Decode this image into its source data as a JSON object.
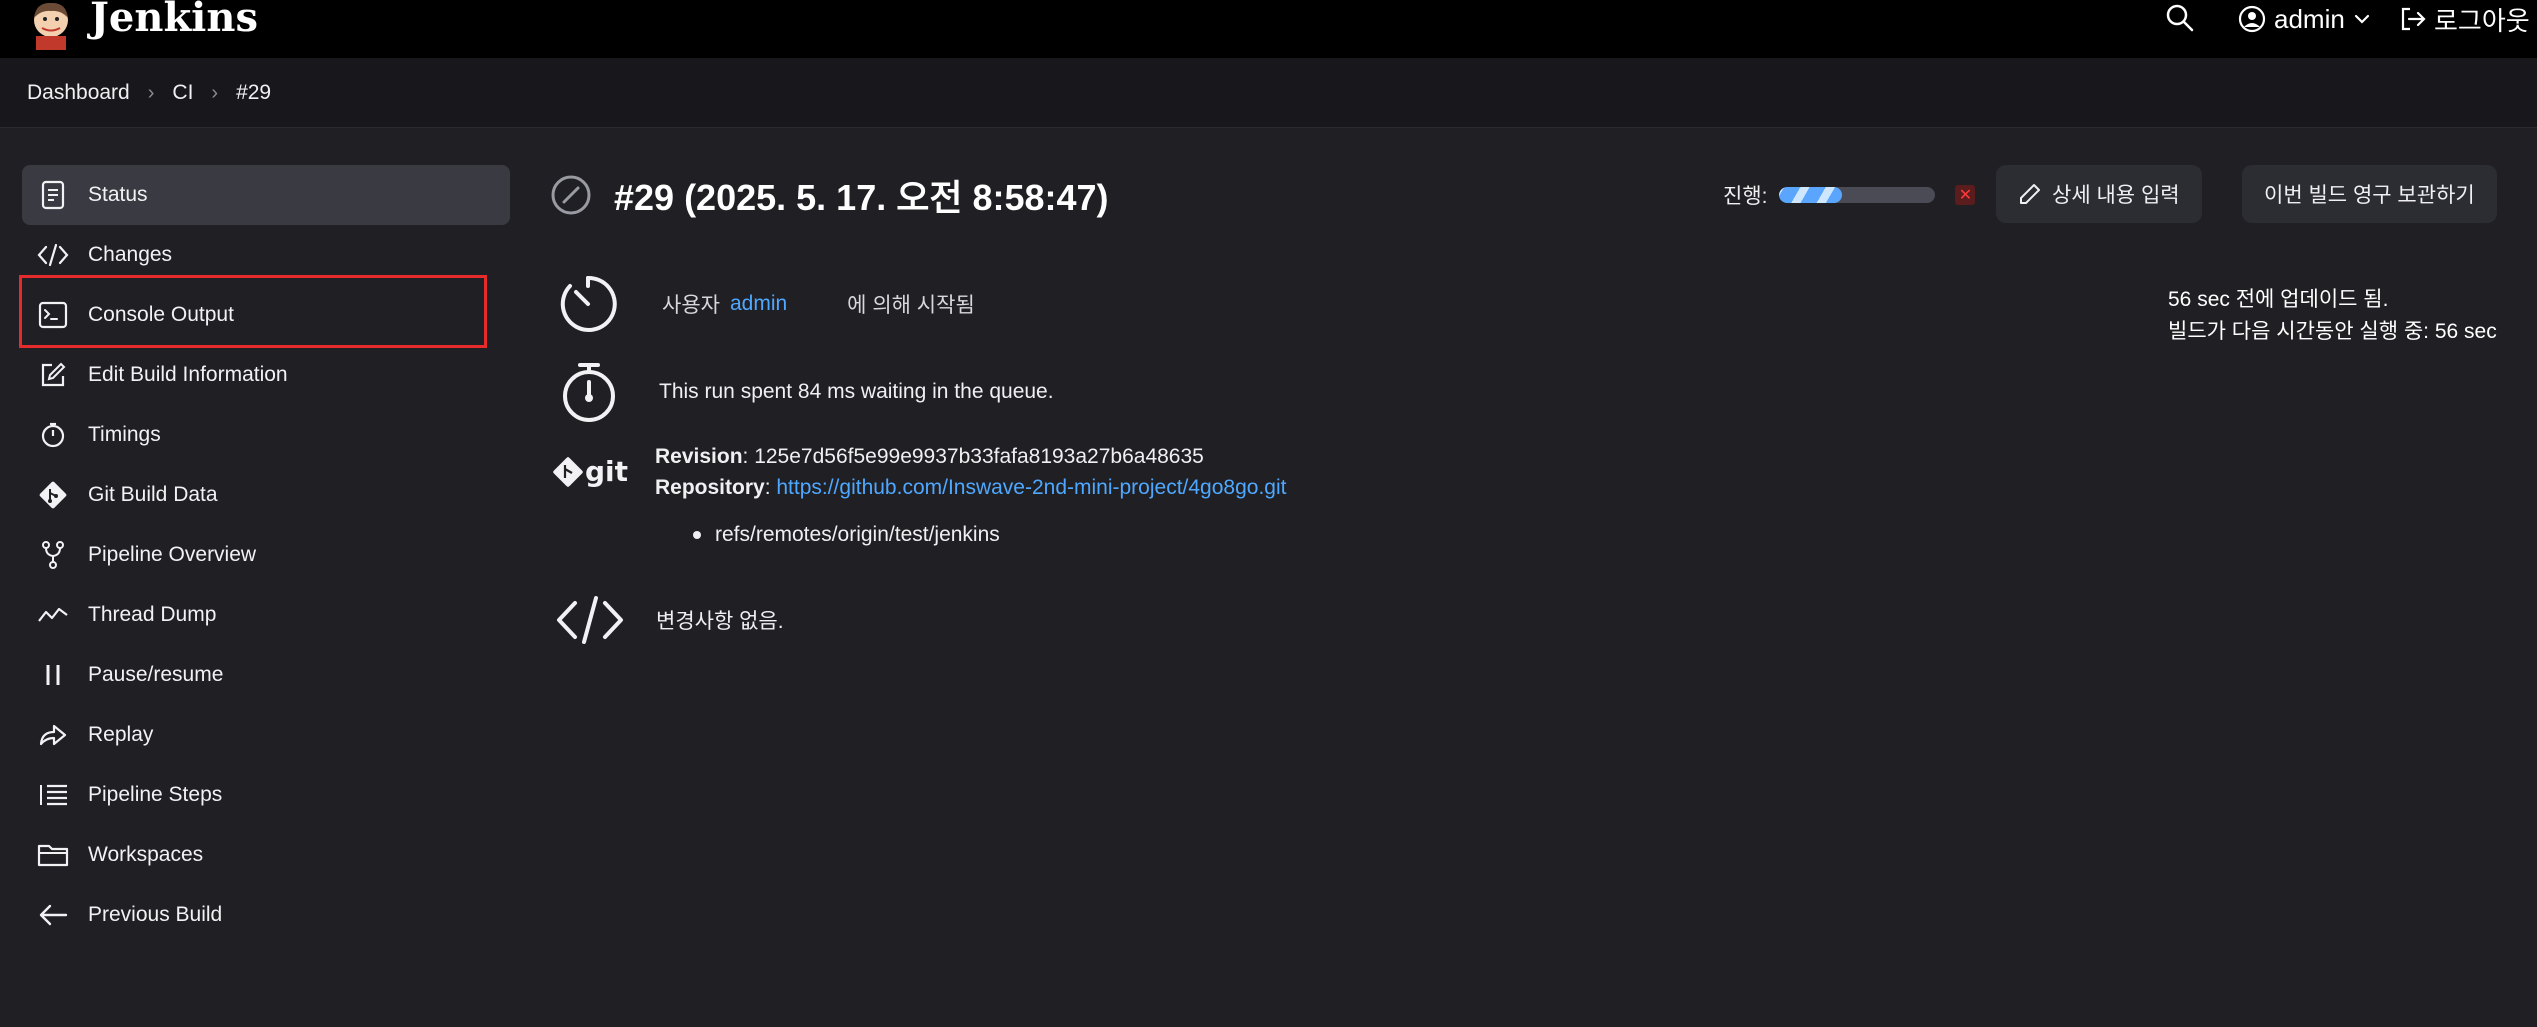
{
  "header": {
    "brand": "Jenkins",
    "user": "admin",
    "logout": "로그아웃"
  },
  "breadcrumb": [
    "Dashboard",
    "CI",
    "#29"
  ],
  "sidebar": {
    "items": [
      {
        "label": "Status",
        "icon": "document-icon"
      },
      {
        "label": "Changes",
        "icon": "code-icon"
      },
      {
        "label": "Console Output",
        "icon": "terminal-icon"
      },
      {
        "label": "Edit Build Information",
        "icon": "edit-icon"
      },
      {
        "label": "Timings",
        "icon": "stopwatch-icon"
      },
      {
        "label": "Git Build Data",
        "icon": "git-icon"
      },
      {
        "label": "Pipeline Overview",
        "icon": "branch-icon"
      },
      {
        "label": "Thread Dump",
        "icon": "activity-icon"
      },
      {
        "label": "Pause/resume",
        "icon": "pause-icon"
      },
      {
        "label": "Replay",
        "icon": "replay-icon"
      },
      {
        "label": "Pipeline Steps",
        "icon": "list-icon"
      },
      {
        "label": "Workspaces",
        "icon": "folder-icon"
      },
      {
        "label": "Previous Build",
        "icon": "arrow-left-icon"
      }
    ]
  },
  "build": {
    "title": "#29 (2025. 5. 17. 오전 8:58:47)",
    "progress_label": "진행:",
    "progress_fraction": 0.4,
    "edit_button": "상세 내용 입력",
    "keep_button": "이번 빌드 영구 보관하기",
    "started_by_prefix": "사용자",
    "started_by_user": "admin",
    "started_by_suffix": "에 의해 시작됨",
    "queue_text": "This run spent 84 ms waiting in the queue.",
    "revision_label": "Revision",
    "revision": "125e7d56f5e99e9937b33fafa8193a27b6a48635",
    "repository_label": "Repository",
    "repository": "https://github.com/Inswave-2nd-mini-project/4go8go.git",
    "ref": "refs/remotes/origin/test/jenkins",
    "no_changes": "변경사항 없음.",
    "updated": "56 sec 전에 업데이드 됨.",
    "running": "빌드가 다음 시간동안 실행 중: 56 sec"
  },
  "colors": {
    "background": "#1f1f24",
    "link": "#4fa8ff",
    "highlight": "#e52b2b"
  }
}
